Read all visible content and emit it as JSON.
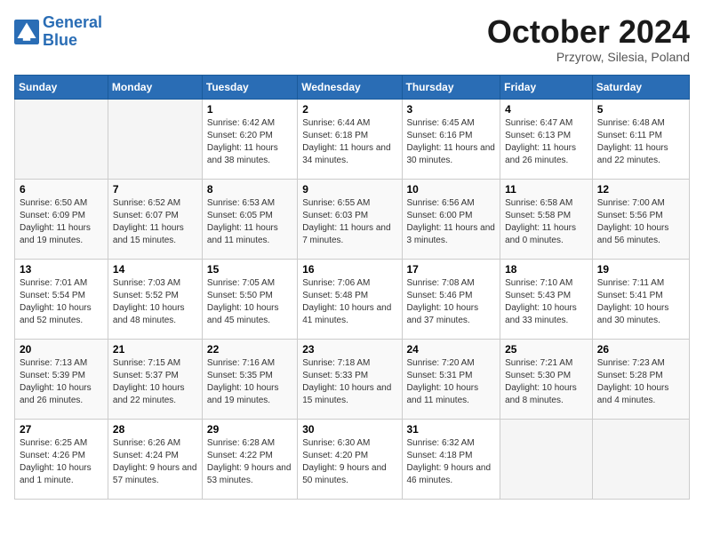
{
  "header": {
    "logo_general": "General",
    "logo_blue": "Blue",
    "month_title": "October 2024",
    "subtitle": "Przyrow, Silesia, Poland"
  },
  "days_of_week": [
    "Sunday",
    "Monday",
    "Tuesday",
    "Wednesday",
    "Thursday",
    "Friday",
    "Saturday"
  ],
  "weeks": [
    [
      {
        "num": "",
        "info": ""
      },
      {
        "num": "",
        "info": ""
      },
      {
        "num": "1",
        "info": "Sunrise: 6:42 AM\nSunset: 6:20 PM\nDaylight: 11 hours and 38 minutes."
      },
      {
        "num": "2",
        "info": "Sunrise: 6:44 AM\nSunset: 6:18 PM\nDaylight: 11 hours and 34 minutes."
      },
      {
        "num": "3",
        "info": "Sunrise: 6:45 AM\nSunset: 6:16 PM\nDaylight: 11 hours and 30 minutes."
      },
      {
        "num": "4",
        "info": "Sunrise: 6:47 AM\nSunset: 6:13 PM\nDaylight: 11 hours and 26 minutes."
      },
      {
        "num": "5",
        "info": "Sunrise: 6:48 AM\nSunset: 6:11 PM\nDaylight: 11 hours and 22 minutes."
      }
    ],
    [
      {
        "num": "6",
        "info": "Sunrise: 6:50 AM\nSunset: 6:09 PM\nDaylight: 11 hours and 19 minutes."
      },
      {
        "num": "7",
        "info": "Sunrise: 6:52 AM\nSunset: 6:07 PM\nDaylight: 11 hours and 15 minutes."
      },
      {
        "num": "8",
        "info": "Sunrise: 6:53 AM\nSunset: 6:05 PM\nDaylight: 11 hours and 11 minutes."
      },
      {
        "num": "9",
        "info": "Sunrise: 6:55 AM\nSunset: 6:03 PM\nDaylight: 11 hours and 7 minutes."
      },
      {
        "num": "10",
        "info": "Sunrise: 6:56 AM\nSunset: 6:00 PM\nDaylight: 11 hours and 3 minutes."
      },
      {
        "num": "11",
        "info": "Sunrise: 6:58 AM\nSunset: 5:58 PM\nDaylight: 11 hours and 0 minutes."
      },
      {
        "num": "12",
        "info": "Sunrise: 7:00 AM\nSunset: 5:56 PM\nDaylight: 10 hours and 56 minutes."
      }
    ],
    [
      {
        "num": "13",
        "info": "Sunrise: 7:01 AM\nSunset: 5:54 PM\nDaylight: 10 hours and 52 minutes."
      },
      {
        "num": "14",
        "info": "Sunrise: 7:03 AM\nSunset: 5:52 PM\nDaylight: 10 hours and 48 minutes."
      },
      {
        "num": "15",
        "info": "Sunrise: 7:05 AM\nSunset: 5:50 PM\nDaylight: 10 hours and 45 minutes."
      },
      {
        "num": "16",
        "info": "Sunrise: 7:06 AM\nSunset: 5:48 PM\nDaylight: 10 hours and 41 minutes."
      },
      {
        "num": "17",
        "info": "Sunrise: 7:08 AM\nSunset: 5:46 PM\nDaylight: 10 hours and 37 minutes."
      },
      {
        "num": "18",
        "info": "Sunrise: 7:10 AM\nSunset: 5:43 PM\nDaylight: 10 hours and 33 minutes."
      },
      {
        "num": "19",
        "info": "Sunrise: 7:11 AM\nSunset: 5:41 PM\nDaylight: 10 hours and 30 minutes."
      }
    ],
    [
      {
        "num": "20",
        "info": "Sunrise: 7:13 AM\nSunset: 5:39 PM\nDaylight: 10 hours and 26 minutes."
      },
      {
        "num": "21",
        "info": "Sunrise: 7:15 AM\nSunset: 5:37 PM\nDaylight: 10 hours and 22 minutes."
      },
      {
        "num": "22",
        "info": "Sunrise: 7:16 AM\nSunset: 5:35 PM\nDaylight: 10 hours and 19 minutes."
      },
      {
        "num": "23",
        "info": "Sunrise: 7:18 AM\nSunset: 5:33 PM\nDaylight: 10 hours and 15 minutes."
      },
      {
        "num": "24",
        "info": "Sunrise: 7:20 AM\nSunset: 5:31 PM\nDaylight: 10 hours and 11 minutes."
      },
      {
        "num": "25",
        "info": "Sunrise: 7:21 AM\nSunset: 5:30 PM\nDaylight: 10 hours and 8 minutes."
      },
      {
        "num": "26",
        "info": "Sunrise: 7:23 AM\nSunset: 5:28 PM\nDaylight: 10 hours and 4 minutes."
      }
    ],
    [
      {
        "num": "27",
        "info": "Sunrise: 6:25 AM\nSunset: 4:26 PM\nDaylight: 10 hours and 1 minute."
      },
      {
        "num": "28",
        "info": "Sunrise: 6:26 AM\nSunset: 4:24 PM\nDaylight: 9 hours and 57 minutes."
      },
      {
        "num": "29",
        "info": "Sunrise: 6:28 AM\nSunset: 4:22 PM\nDaylight: 9 hours and 53 minutes."
      },
      {
        "num": "30",
        "info": "Sunrise: 6:30 AM\nSunset: 4:20 PM\nDaylight: 9 hours and 50 minutes."
      },
      {
        "num": "31",
        "info": "Sunrise: 6:32 AM\nSunset: 4:18 PM\nDaylight: 9 hours and 46 minutes."
      },
      {
        "num": "",
        "info": ""
      },
      {
        "num": "",
        "info": ""
      }
    ]
  ]
}
